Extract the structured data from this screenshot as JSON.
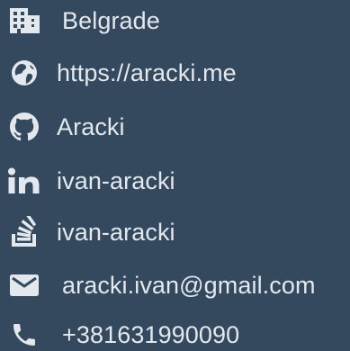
{
  "colors": {
    "background": "#34495e",
    "foreground": "#e3e8ee"
  },
  "contacts": [
    {
      "icon": "building-icon",
      "text": "Belgrade"
    },
    {
      "icon": "globe-icon",
      "text": "https://aracki.me"
    },
    {
      "icon": "github-icon",
      "text": "Aracki"
    },
    {
      "icon": "linkedin-icon",
      "text": "ivan-aracki"
    },
    {
      "icon": "stack-overflow-icon",
      "text": "ivan-aracki"
    },
    {
      "icon": "envelope-icon",
      "text": "aracki.ivan@gmail.com"
    },
    {
      "icon": "phone-icon",
      "text": "+381631990090"
    }
  ]
}
